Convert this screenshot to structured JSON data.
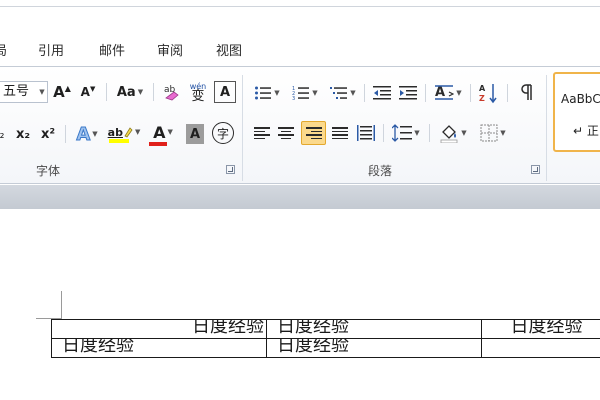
{
  "menu": {
    "tabs": [
      "局",
      "引用",
      "邮件",
      "审阅",
      "视图"
    ]
  },
  "ribbon": {
    "font_group": {
      "label": "字体",
      "font_size_value": "五号",
      "grow_font_glyph": "A",
      "shrink_font_glyph": "A",
      "change_case_label": "Aa",
      "pinyin_glyph": "wén",
      "clear_format_glyph": "A",
      "subscript_label": "x₂",
      "superscript_label": "x²",
      "text_effect_glyph": "A",
      "highlight_label": "ab",
      "font_color_glyph": "A",
      "char_shading_glyph": "A",
      "enclose_glyph": "字",
      "bold_fragment": "₂",
      "highlight_color": "#ffff00",
      "font_color": "#e0201b"
    },
    "paragraph_group": {
      "label": "段落"
    },
    "styles_group": {
      "sample_text": "AaBbC",
      "style_name": "↵ 正"
    }
  },
  "document": {
    "table": [
      [
        "日度经验",
        "日度经验",
        "日度经验"
      ],
      [
        "日度经验",
        "日度经验",
        ""
      ]
    ]
  }
}
